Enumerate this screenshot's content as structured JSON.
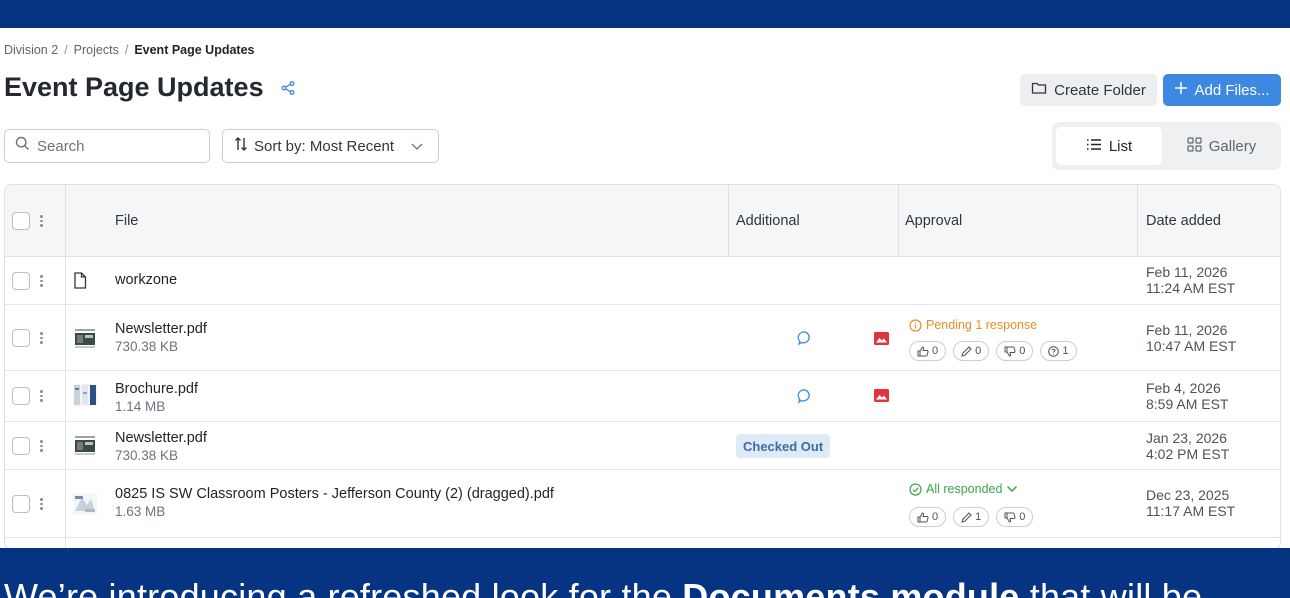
{
  "breadcrumb": {
    "items": [
      "Division 2",
      "Projects"
    ],
    "separator": "/",
    "current": "Event Page Updates"
  },
  "page": {
    "title": "Event Page Updates"
  },
  "actions": {
    "create_folder": "Create Folder",
    "add_files": "Add Files..."
  },
  "search": {
    "placeholder": "Search",
    "value": ""
  },
  "sort": {
    "label": "Sort by: Most Recent"
  },
  "view_toggle": {
    "list": "List",
    "gallery": "Gallery",
    "selected": "List"
  },
  "table": {
    "columns": [
      "File",
      "Additional",
      "Approval",
      "Date added"
    ],
    "rows": [
      {
        "name": "workzone",
        "size": "",
        "date": "Feb 11, 2026",
        "time": "11:24 AM EST"
      },
      {
        "name": "Newsletter.pdf",
        "size": "730.38 KB",
        "date": "Feb 11, 2026",
        "time": "10:47 AM EST",
        "approval_status": "Pending 1 response",
        "counts": {
          "approve": "0",
          "edit": "0",
          "reject": "0",
          "pending": "1"
        }
      },
      {
        "name": "Brochure.pdf",
        "size": "1.14 MB",
        "date": "Feb 4, 2026",
        "time": "8:59 AM EST"
      },
      {
        "name": "Newsletter.pdf",
        "size": "730.38 KB",
        "date": "Jan 23, 2026",
        "time": "4:02 PM EST",
        "badge": "Checked Out"
      },
      {
        "name": "0825 IS SW Classroom Posters - Jefferson County (2) (dragged).pdf",
        "size": "1.63 MB",
        "date": "Dec 23, 2025",
        "time": "11:17 AM EST",
        "approval_status": "All responded",
        "counts": {
          "approve": "0",
          "edit": "1",
          "reject": "0"
        }
      }
    ]
  },
  "banner": {
    "text_before": "We’re introducing a refreshed look for the ",
    "text_bold": "Documents module",
    "text_after": " that will be"
  },
  "colors": {
    "brand_navy": "#063382",
    "primary_blue": "#3d88e0",
    "pending_orange": "#e5902a",
    "success_green": "#3aa64e",
    "image_badge_red": "#e0353b",
    "comment_blue": "#3d88e0"
  },
  "icons": [
    "share-icon",
    "folder-icon",
    "plus-icon",
    "search-icon",
    "sort-icon",
    "chevron-down-icon",
    "list-icon",
    "gallery-icon",
    "file-icon",
    "comment-icon",
    "image-icon",
    "info-icon",
    "check-circle-icon",
    "thumbs-up-icon",
    "pencil-icon",
    "thumbs-down-icon",
    "question-icon"
  ]
}
